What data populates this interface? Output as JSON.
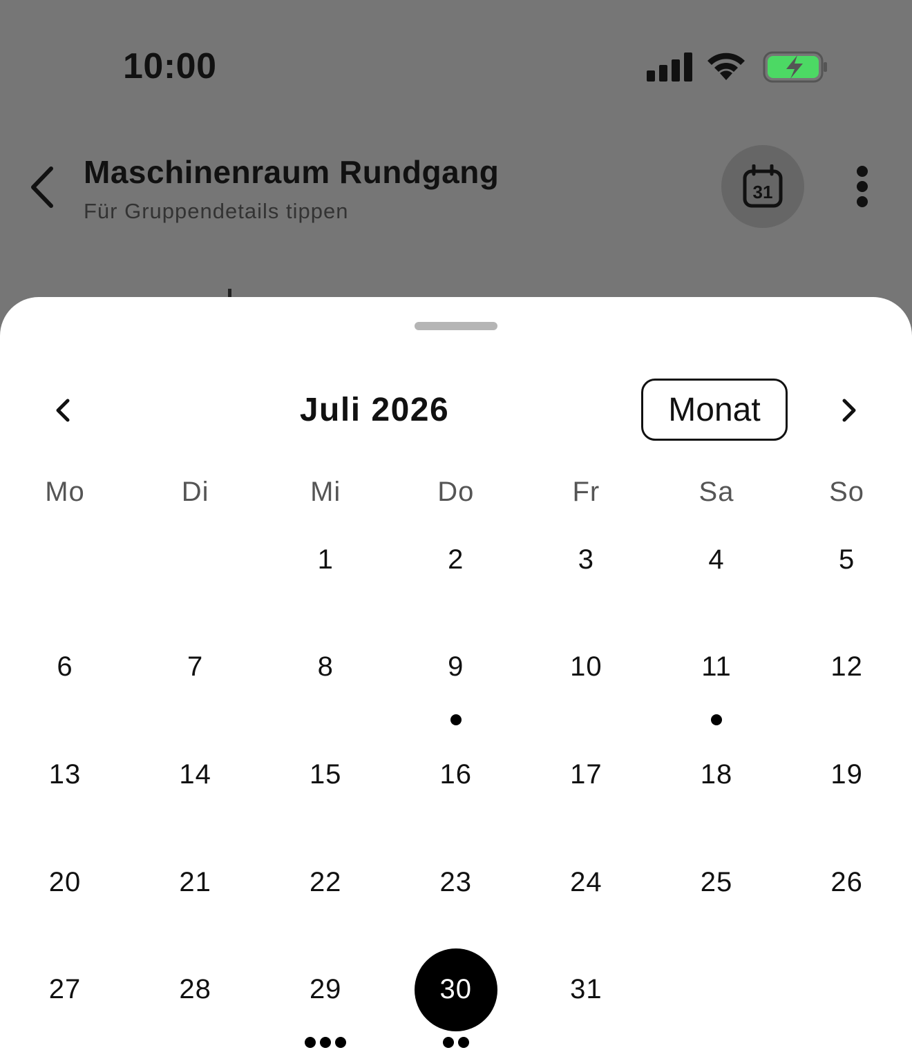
{
  "status_bar": {
    "time": "10:00",
    "signal_icon": "cellular-signal-icon",
    "wifi_icon": "wifi-icon",
    "battery_icon": "battery-charging-icon",
    "battery_color": "#4cd964"
  },
  "header": {
    "title": "Maschinenraum Rundgang",
    "subtitle": "Für Gruppendetails tippen",
    "back_icon": "chevron-left-icon",
    "calendar_icon": "calendar-31-icon",
    "calendar_icon_text": "31",
    "more_icon": "more-vertical-icon"
  },
  "calendar": {
    "month_label": "Juli 2026",
    "view_mode": "Monat",
    "prev_icon": "chevron-left-icon",
    "next_icon": "chevron-right-icon",
    "weekdays": [
      "Mo",
      "Di",
      "Mi",
      "Do",
      "Fr",
      "Sa",
      "So"
    ],
    "first_weekday_index": 2,
    "days_in_month": 31,
    "selected_day": 30,
    "event_dots": {
      "9": 1,
      "11": 1,
      "29": 3,
      "30": 2
    },
    "selected_color": "#000000"
  }
}
